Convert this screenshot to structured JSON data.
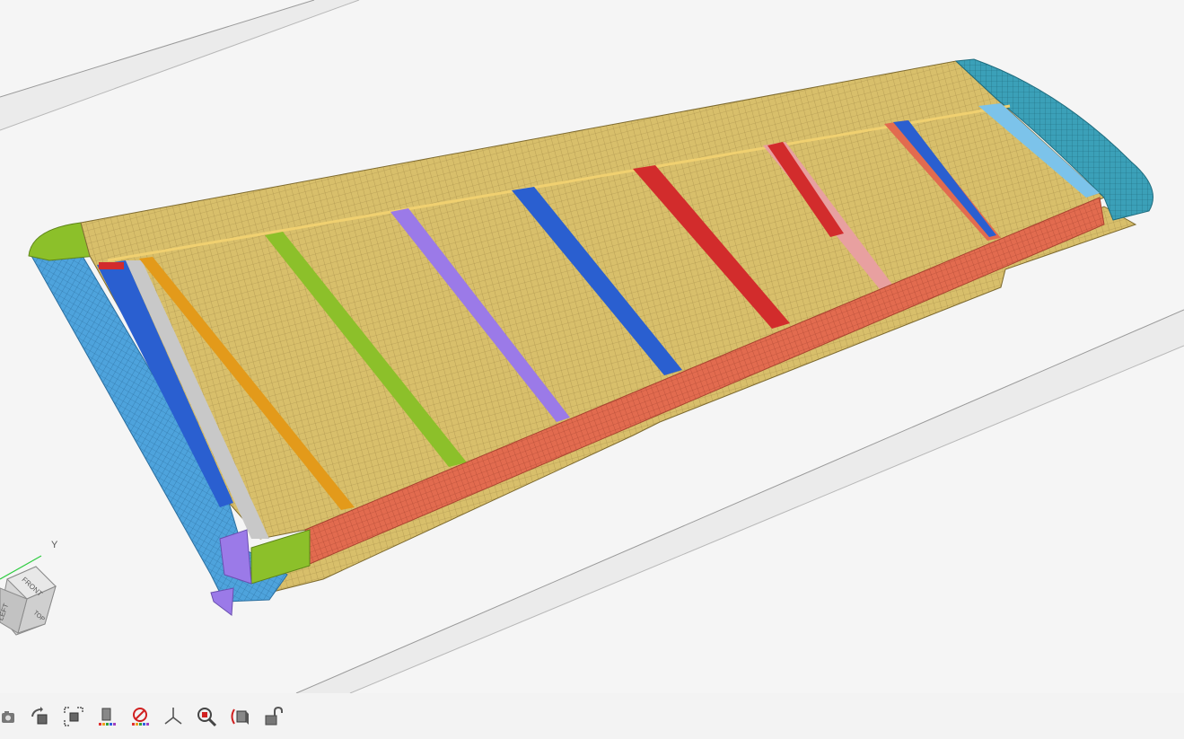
{
  "viewport": {
    "model": "wing-mesh",
    "colors": {
      "skin": "#d8bf6b",
      "skin_mesh": "#9a8440",
      "spar": "#e26b4f",
      "leading_edge": "#4ea3dc",
      "tip": "#3ba0b8",
      "root_green": "#8cc02a",
      "rib_blue": "#2a5fd0",
      "rib_green": "#8cc02a",
      "rib_orange": "#e39a1a",
      "rib_purple": "#9b7ae8",
      "rib_red": "#d22c2c",
      "rib_pink": "#e8a0a0",
      "rib_gray": "#c8c8c8",
      "rib_lightblue": "#7cc3ea",
      "background": "#f5f5f5"
    }
  },
  "view_cube": {
    "front": "FRONT",
    "left": "LEFT",
    "top": "TOP",
    "axis_y": "Y"
  },
  "toolbar": {
    "items": [
      {
        "name": "camera-icon"
      },
      {
        "name": "rotate-view-icon"
      },
      {
        "name": "fit-view-icon"
      },
      {
        "name": "color-by-part-icon"
      },
      {
        "name": "hide-icon"
      },
      {
        "name": "axes-icon"
      },
      {
        "name": "zoom-icon"
      },
      {
        "name": "perspective-icon"
      },
      {
        "name": "unlock-icon"
      }
    ]
  }
}
